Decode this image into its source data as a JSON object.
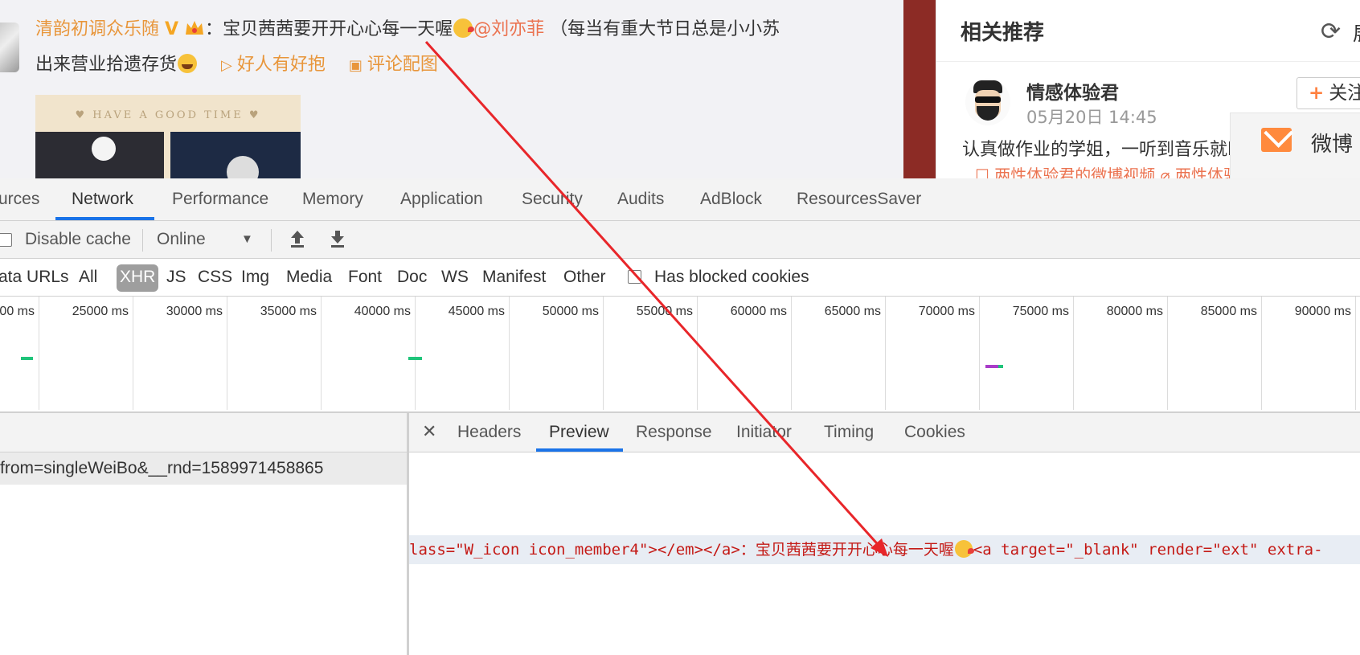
{
  "post": {
    "author": "清韵初调众乐随",
    "v_badge": "V",
    "colon": "：",
    "text1": "宝贝茜茜要开开心心每一天喔",
    "mention": "@刘亦菲",
    "text2": "（每当有重大节日总是小小苏",
    "text3": "出来营业拾遗存货",
    "link1": "好人有好抱",
    "link2": "评论配图",
    "image_caption": "♥ HAVE A GOOD TIME ♥"
  },
  "recommend": {
    "title": "相关推荐",
    "refresh_label": "展",
    "user_name": "情感体验君",
    "user_time": "05月20日 14:45",
    "follow_label": "关注",
    "text": "认真做作业的学姐，一听到音乐就h起来",
    "links": "☐ 两性体验君的微博视频    ⌀ 两性体验",
    "popup_label": "微博"
  },
  "devtools": {
    "tabs": [
      "urces",
      "Network",
      "Performance",
      "Memory",
      "Application",
      "Security",
      "Audits",
      "AdBlock",
      "ResourcesSaver"
    ],
    "active_tab": "Network",
    "toolbar": {
      "disable_cache": "Disable cache",
      "throttle": "Online",
      "throttle_arrow": "▼",
      "upload_icon": "upload-har-icon",
      "download_icon": "download-har-icon"
    },
    "filters": [
      "ata URLs",
      "All",
      "XHR",
      "JS",
      "CSS",
      "Img",
      "Media",
      "Font",
      "Doc",
      "WS",
      "Manifest",
      "Other"
    ],
    "active_filter": "XHR",
    "has_blocked_cookies": "Has blocked cookies",
    "timeline_ticks": [
      "00 ms",
      "25000 ms",
      "30000 ms",
      "35000 ms",
      "40000 ms",
      "45000 ms",
      "50000 ms",
      "55000 ms",
      "60000 ms",
      "65000 ms",
      "70000 ms",
      "75000 ms",
      "80000 ms",
      "85000 ms",
      "90000 ms"
    ],
    "request_row": "from=singleWeiBo&__rnd=1589971458865",
    "detail_tabs": [
      "Headers",
      "Preview",
      "Response",
      "Initiator",
      "Timing",
      "Cookies"
    ],
    "active_detail_tab": "Preview",
    "close_label": "✕",
    "code_before": "lass=\"W_icon icon_member4\"></em></a>：",
    "code_cjk": "宝贝茜茜要开开心心每一天喔",
    "code_after": "<a target=\"_blank\" render=\"ext\" extra-"
  },
  "colors": {
    "accent_blue": "#1a73e8",
    "weibo_orange": "#e8963b",
    "code_red": "#c41a16",
    "arrow_red": "#e8262a",
    "waterfall_green": "#1fc47a",
    "waterfall_purple": "#a93cc9"
  }
}
